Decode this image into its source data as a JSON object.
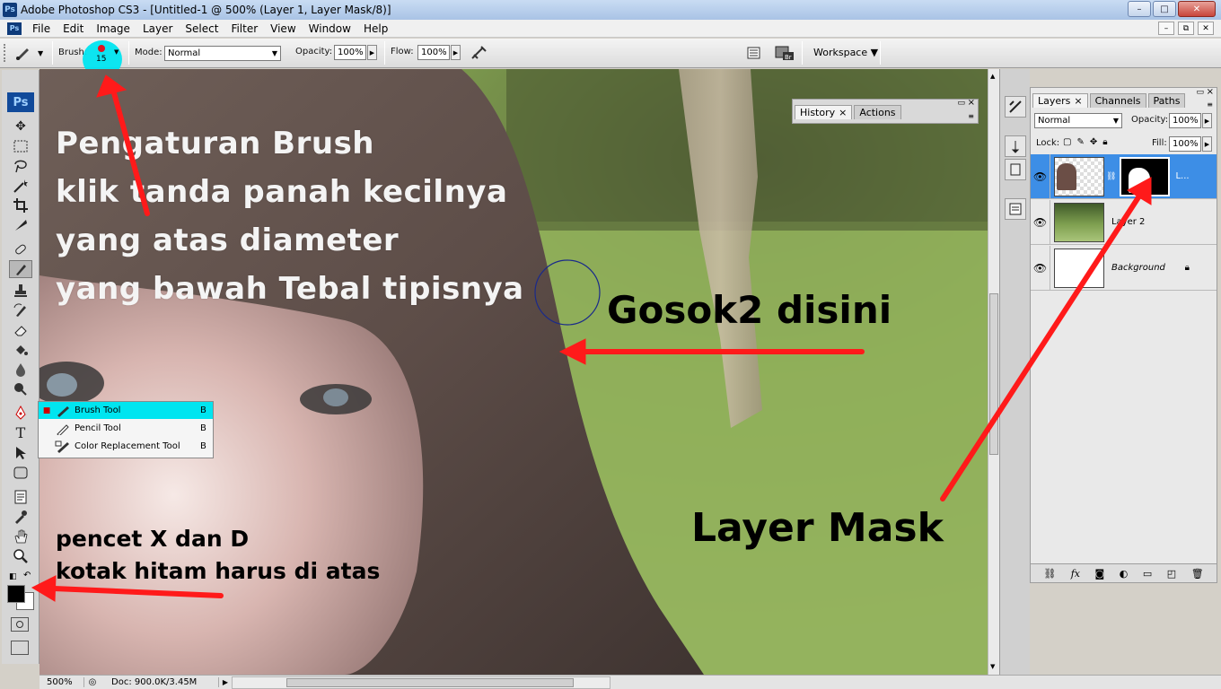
{
  "window": {
    "title": "Adobe Photoshop CS3 - [Untitled-1 @ 500% (Layer 1, Layer Mask/8)]",
    "app_logo": "Ps",
    "buttons": {
      "minimize": "–",
      "maximize": "□",
      "close": "✕"
    }
  },
  "menubar": {
    "logo": "Ps",
    "items": [
      "File",
      "Edit",
      "Image",
      "Layer",
      "Select",
      "Filter",
      "View",
      "Window",
      "Help"
    ],
    "doc_buttons": [
      "–",
      "⧉",
      "✕"
    ]
  },
  "options": {
    "brush_label": "Brush:",
    "brush_size": "15",
    "mode_label": "Mode:",
    "mode_value": "Normal",
    "opacity_label": "Opacity:",
    "opacity_value": "100%",
    "flow_label": "Flow:",
    "flow_value": "100%",
    "workspace_label": "Workspace ▼"
  },
  "toolbox": {
    "logo": "Ps",
    "tools": [
      "move-tool-icon",
      "marquee-tool-icon",
      "lasso-tool-icon",
      "magic-wand-icon",
      "crop-tool-icon",
      "slice-tool-icon",
      "healing-brush-icon",
      "brush-tool-icon",
      "clone-stamp-icon",
      "history-brush-icon",
      "eraser-icon",
      "paint-bucket-icon",
      "blur-tool-icon",
      "dodge-tool-icon",
      "pen-tool-icon",
      "type-tool-icon",
      "path-selection-icon",
      "shape-tool-icon",
      "notes-tool-icon",
      "eyedropper-icon",
      "hand-tool-icon",
      "zoom-tool-icon"
    ]
  },
  "flyout": {
    "items": [
      {
        "label": "Brush Tool",
        "shortcut": "B",
        "selected": true
      },
      {
        "label": "Pencil Tool",
        "shortcut": "B",
        "selected": false
      },
      {
        "label": "Color Replacement Tool",
        "shortcut": "B",
        "selected": false
      }
    ]
  },
  "history_panel": {
    "tabs": [
      "History",
      "Actions"
    ]
  },
  "layers_panel": {
    "tabs": [
      "Layers",
      "Channels",
      "Paths"
    ],
    "blend_mode": "Normal",
    "opacity_label": "Opacity:",
    "opacity_value": "100%",
    "lock_label": "Lock:",
    "fill_label": "Fill:",
    "fill_value": "100%",
    "layers": [
      {
        "name": "L...",
        "selected": true
      },
      {
        "name": "Layer 2",
        "selected": false
      },
      {
        "name": "Background",
        "selected": false
      }
    ],
    "footer_icons": [
      "link-icon",
      "fx-icon",
      "mask-icon",
      "adjustment-icon",
      "folder-icon",
      "new-layer-icon",
      "trash-icon"
    ]
  },
  "statusbar": {
    "zoom": "500%",
    "doc": "Doc: 900.0K/3.45M"
  },
  "annotations": {
    "brush_note": [
      "Pengaturan Brush",
      "klik tanda panah kecilnya",
      "yang atas diameter",
      "yang bawah Tebal tipisnya"
    ],
    "rub_note": "Gosok2 disini",
    "key_note": [
      "pencet X dan D",
      "kotak hitam harus di atas"
    ],
    "mask_note": "Layer Mask"
  },
  "colors": {
    "annotation_arrow": "#ff1a1a",
    "highlight": "#00e5f0",
    "selection_blue": "#3d8ee6"
  }
}
